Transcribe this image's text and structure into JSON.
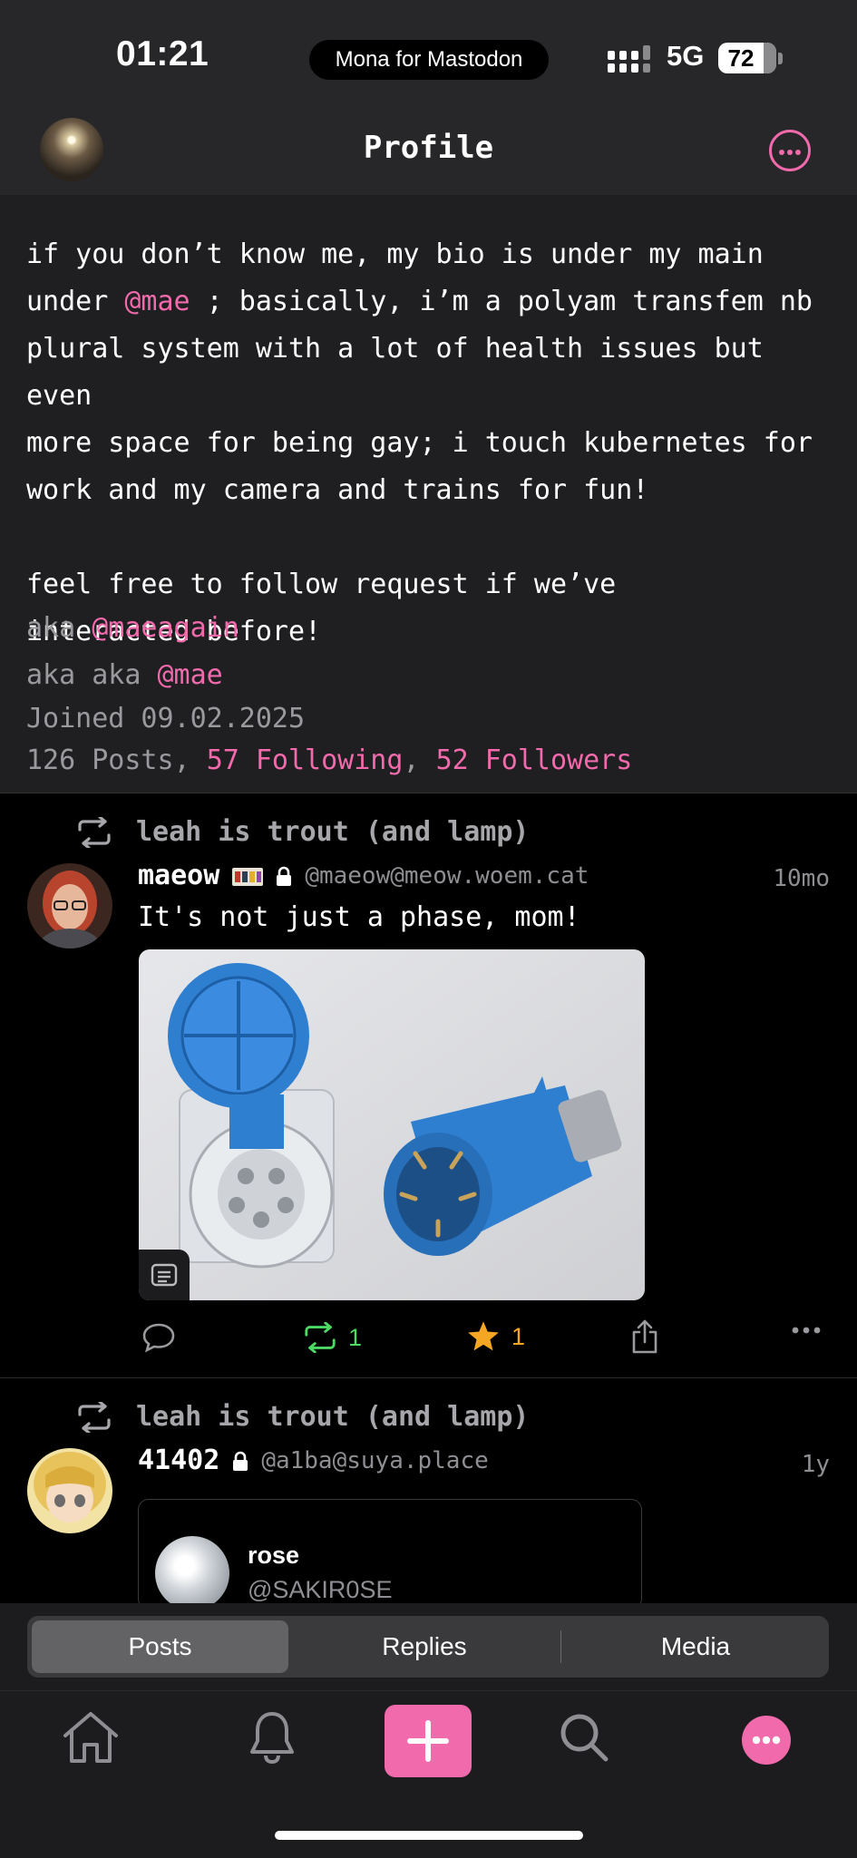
{
  "status_bar": {
    "time": "01:21",
    "app_name": "Mona for Mastodon",
    "network": "5G",
    "battery": "72"
  },
  "nav": {
    "title": "Profile"
  },
  "bio": {
    "paragraph_1_before_mention": "if you don’t know me, my bio is under my main\nunder ",
    "paragraph_1_mention": "@mae",
    "paragraph_1_after_mention": " ; basically, i’m a polyam transfem nb\nplural system with a lot of health issues but even\nmore space for being gay; i touch kubernetes for\nwork and my camera and trains for fun!\n\nfeel free to follow request if we’ve\ninteracted before!",
    "aka_1_label": "aka ",
    "aka_1_handle": "@maeagain",
    "aka_2_label": "aka aka ",
    "aka_2_handle": "@mae",
    "joined": "Joined 09.02.2025",
    "posts_count": "126 Posts",
    "comma": ",",
    "following": "57 Following",
    "followers": "52 Followers"
  },
  "posts": [
    {
      "boosted_by": "leah is trout (and lamp)",
      "name": "maeow",
      "handle": "@maeow@meow.woem.cat",
      "time": "10mo",
      "text": "It's not just a phase, mom!",
      "boosts": "1",
      "favourites": "1"
    },
    {
      "boosted_by": "leah is trout (and lamp)",
      "name": "41402",
      "handle": "@a1ba@suya.place",
      "time": "1y",
      "quote_name": "rose",
      "quote_handle": "@SAKIR0SE"
    }
  ],
  "segments": [
    "Posts",
    "Replies",
    "Media"
  ],
  "colors": {
    "accent": "#f06aac",
    "boost_green": "#4cd964",
    "star_orange": "#f5a623"
  }
}
